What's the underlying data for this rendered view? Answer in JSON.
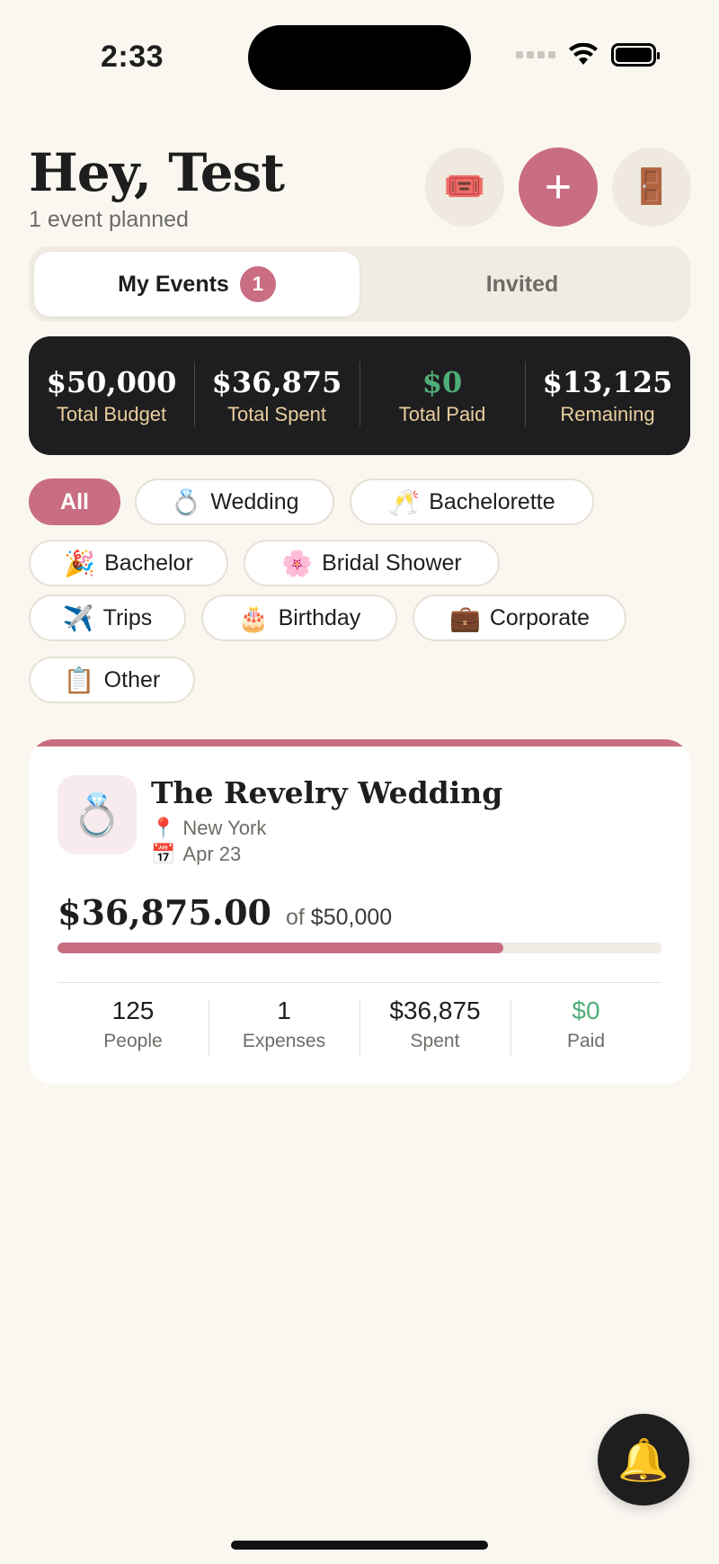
{
  "status_bar": {
    "time": "2:33"
  },
  "header": {
    "greeting": "Hey, Test",
    "subtitle": "1 event planned",
    "icons": {
      "ticket": "🎟️",
      "add": "+",
      "door": "🚪"
    }
  },
  "tabs": [
    {
      "label": "My Events",
      "badge": "1",
      "active": true
    },
    {
      "label": "Invited",
      "active": false
    }
  ],
  "summary": [
    {
      "value": "$50,000",
      "label": "Total Budget"
    },
    {
      "value": "$36,875",
      "label": "Total Spent"
    },
    {
      "value": "$0",
      "label": "Total Paid"
    },
    {
      "value": "$13,125",
      "label": "Remaining"
    }
  ],
  "filters": [
    {
      "label": "All",
      "icon": "",
      "active": true
    },
    {
      "label": "Wedding",
      "icon": "💍"
    },
    {
      "label": "Bachelorette",
      "icon": "🥂"
    },
    {
      "label": "Bachelor",
      "icon": "🎉"
    },
    {
      "label": "Bridal Shower",
      "icon": "🌸"
    },
    {
      "label": "Trips",
      "icon": "✈️"
    },
    {
      "label": "Birthday",
      "icon": "🎂"
    },
    {
      "label": "Corporate",
      "icon": "💼"
    },
    {
      "label": "Other",
      "icon": "📋"
    }
  ],
  "event": {
    "icon": "💍",
    "name": "The Revelry Wedding",
    "location_icon": "📍",
    "location": "New York",
    "date_icon": "📅",
    "date": "Apr 23",
    "spent_amount": "$36,875.00",
    "of_label": "of",
    "budget": "$50,000",
    "progress_fraction": 0.7375,
    "stats": [
      {
        "value": "125",
        "label": "People"
      },
      {
        "value": "1",
        "label": "Expenses"
      },
      {
        "value": "$36,875",
        "label": "Spent"
      },
      {
        "value": "$0",
        "label": "Paid"
      }
    ]
  },
  "bell_icon": "🔔",
  "colors": {
    "accent": "#c96e82",
    "dark": "#1e1d1f",
    "green": "#4fae78",
    "gold": "#e8cf9e",
    "background": "#faf7f1"
  }
}
